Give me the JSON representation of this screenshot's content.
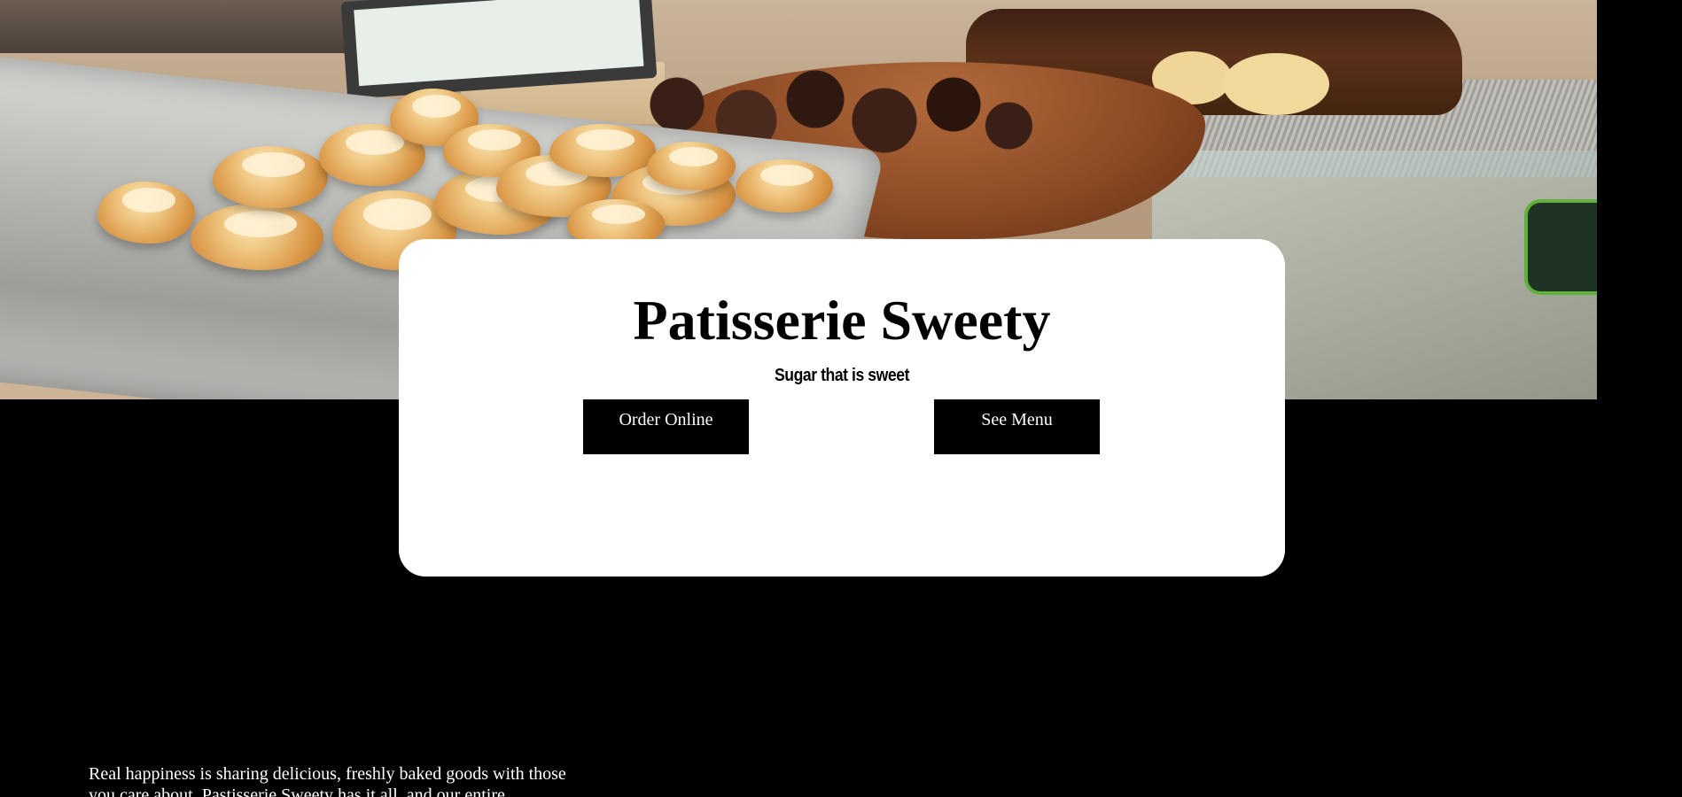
{
  "hero": {
    "image_alt": "Pastries and brownies on display at the bakery counter",
    "title": "Patisserie Sweety",
    "tagline": "Sugar that is sweet",
    "buttons": {
      "order_label": "Order Online",
      "menu_label": "See Menu"
    }
  },
  "intro": {
    "text": "Real happiness is sharing delicious, freshly baked goods with those you care about. Pastisserie Sweety has it all, and our entire"
  },
  "colors": {
    "page_background": "#000000",
    "card_background": "#ffffff",
    "button_background": "#000000",
    "button_text": "#ffffff",
    "body_text": "#ffffff"
  }
}
